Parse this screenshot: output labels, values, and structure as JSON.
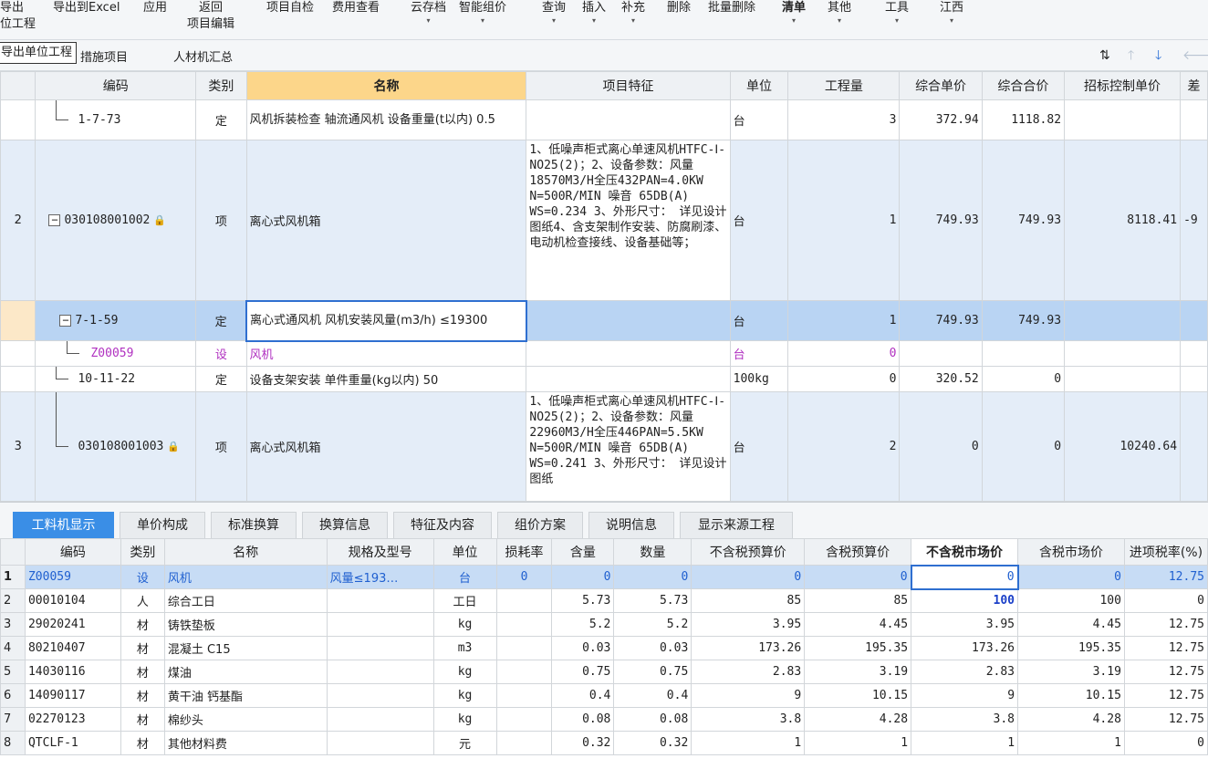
{
  "toolbar": {
    "items": [
      {
        "label": "导出",
        "sub": "位工程",
        "arrow": false
      },
      {
        "label": "导出到Excel",
        "arrow": false
      },
      {
        "label": "应用",
        "arrow": false
      },
      {
        "label": "返回",
        "sub": "项目编辑",
        "arrow": false
      },
      {
        "label": "项目自检",
        "arrow": false
      },
      {
        "label": "费用查看",
        "arrow": false
      },
      {
        "label": "云存档",
        "arrow": true
      },
      {
        "label": "智能组价",
        "arrow": true
      },
      {
        "label": "查询",
        "arrow": true
      },
      {
        "label": "插入",
        "arrow": true
      },
      {
        "label": "补充",
        "arrow": true
      },
      {
        "label": "删除",
        "arrow": false
      },
      {
        "label": "批量删除",
        "arrow": false
      },
      {
        "label": "清单",
        "arrow": true
      },
      {
        "label": "其他",
        "arrow": true
      },
      {
        "label": "工具",
        "arrow": true
      },
      {
        "label": "江西",
        "arrow": true
      }
    ],
    "arrow_glyph": "▾"
  },
  "export_tip": "导出单位工程",
  "page_tabs": [
    "措施项目",
    "人材机汇总"
  ],
  "nav_icons": {
    "sort": "⇅",
    "up": "🡑",
    "down": "🡓",
    "back": "🡐"
  },
  "upper": {
    "headers": [
      "编码",
      "类别",
      "名称",
      "项目特征",
      "单位",
      "工程量",
      "综合单价",
      "综合合价",
      "招标控制单价",
      "差"
    ],
    "rows": [
      {
        "idx": "",
        "code": "1-7-73",
        "type": "定",
        "name": "风机拆装检查 轴流通风机 设备重量(t以内) 0.5",
        "feature": "",
        "unit": "台",
        "qty": "3",
        "price": "372.94",
        "total": "1118.82",
        "ctrl": "",
        "diff": ""
      },
      {
        "idx": "2",
        "code": "030108001002",
        "type": "项",
        "name": "离心式风机箱",
        "feature": "1、低噪声柜式离心单速风机HTFC-Ⅰ-NO25(2)；2、设备参数：风量18570M3/H全压432PAN=4.0KW N=500R/MIN 噪音 65DB(A) WS=0.234 3、外形尺寸： 详见设计图纸4、含支架制作安装、防腐刷漆、电动机检查接线、设备基础等；",
        "unit": "台",
        "qty": "1",
        "price": "749.93",
        "total": "749.93",
        "ctrl": "8118.41",
        "diff": "-9"
      },
      {
        "idx": "",
        "code": "7-1-59",
        "type": "定",
        "name": "离心式通风机 风机安装风量(m3/h) ≤19300",
        "feature": "",
        "unit": "台",
        "qty": "1",
        "price": "749.93",
        "total": "749.93",
        "ctrl": "",
        "diff": ""
      },
      {
        "idx": "",
        "code": "Z00059",
        "type": "设",
        "name": "风机",
        "feature": "",
        "unit": "台",
        "qty": "0",
        "price": "",
        "total": "",
        "ctrl": "",
        "diff": ""
      },
      {
        "idx": "",
        "code": "10-11-22",
        "type": "定",
        "name": "设备支架安装 单件重量(kg以内) 50",
        "feature": "",
        "unit": "100kg",
        "qty": "0",
        "price": "320.52",
        "total": "0",
        "ctrl": "",
        "diff": ""
      },
      {
        "idx": "3",
        "code": "030108001003",
        "type": "项",
        "name": "离心式风机箱",
        "feature": "1、低噪声柜式离心单速风机HTFC-Ⅰ-NO25(2)；2、设备参数：风量22960M3/H全压446PAN=5.5KW N=500R/MIN 噪音 65DB(A) WS=0.241 3、外形尺寸： 详见设计图纸",
        "unit": "台",
        "qty": "2",
        "price": "0",
        "total": "0",
        "ctrl": "10240.64",
        "diff": ""
      }
    ]
  },
  "detail_tabs": [
    "工料机显示",
    "单价构成",
    "标准换算",
    "换算信息",
    "特征及内容",
    "组价方案",
    "说明信息",
    "显示来源工程"
  ],
  "lower": {
    "headers": [
      "",
      "编码",
      "类别",
      "名称",
      "规格及型号",
      "单位",
      "损耗率",
      "含量",
      "数量",
      "不含税预算价",
      "含税预算价",
      "不含税市场价",
      "含税市场价",
      "进项税率(%)"
    ],
    "rows": [
      [
        "1",
        "Z00059",
        "设",
        "风机",
        "风量≤193…",
        "台",
        "0",
        "0",
        "0",
        "0",
        "0",
        "0",
        "0",
        "12.75"
      ],
      [
        "2",
        "00010104",
        "人",
        "综合工日",
        "",
        "工日",
        "",
        "5.73",
        "5.73",
        "85",
        "85",
        "100",
        "100",
        "0"
      ],
      [
        "3",
        "29020241",
        "材",
        "铸铁垫板",
        "",
        "kg",
        "",
        "5.2",
        "5.2",
        "3.95",
        "4.45",
        "3.95",
        "4.45",
        "12.75"
      ],
      [
        "4",
        "80210407",
        "材",
        "混凝土 C15",
        "",
        "m3",
        "",
        "0.03",
        "0.03",
        "173.26",
        "195.35",
        "173.26",
        "195.35",
        "12.75"
      ],
      [
        "5",
        "14030116",
        "材",
        "煤油",
        "",
        "kg",
        "",
        "0.75",
        "0.75",
        "2.83",
        "3.19",
        "2.83",
        "3.19",
        "12.75"
      ],
      [
        "6",
        "14090117",
        "材",
        "黄干油 钙基酯",
        "",
        "kg",
        "",
        "0.4",
        "0.4",
        "9",
        "10.15",
        "9",
        "10.15",
        "12.75"
      ],
      [
        "7",
        "02270123",
        "材",
        "棉纱头",
        "",
        "kg",
        "",
        "0.08",
        "0.08",
        "3.8",
        "4.28",
        "3.8",
        "4.28",
        "12.75"
      ],
      [
        "8",
        "QTCLF-1",
        "材",
        "其他材料费",
        "",
        "元",
        "",
        "0.32",
        "0.32",
        "1",
        "1",
        "1",
        "1",
        "0"
      ]
    ]
  },
  "colors": {
    "accent": "#3a8ee6",
    "selection": "#b9d4f3",
    "itemRow": "#e4edf8",
    "purple": "#b030c0"
  }
}
